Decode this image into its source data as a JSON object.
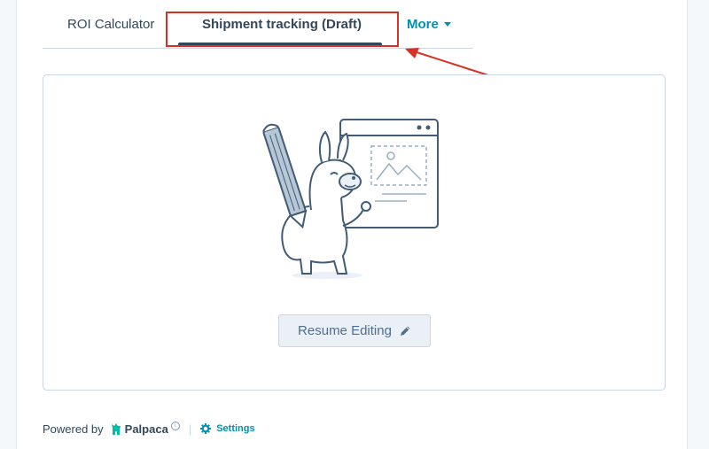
{
  "tabs": {
    "roi_label": "ROI Calculator",
    "shipment_label": "Shipment tracking (Draft)",
    "more_label": "More"
  },
  "card": {
    "resume_button_label": "Resume Editing",
    "illustration_icon": "llama-drawing-illustration"
  },
  "footer": {
    "powered_by": "Powered by",
    "brand": "Palpaca",
    "settings_label": "Settings"
  },
  "colors": {
    "accent": "#0091ae",
    "text": "#33475b",
    "annotation": "#d93025",
    "button_bg": "#eaf0f6"
  }
}
